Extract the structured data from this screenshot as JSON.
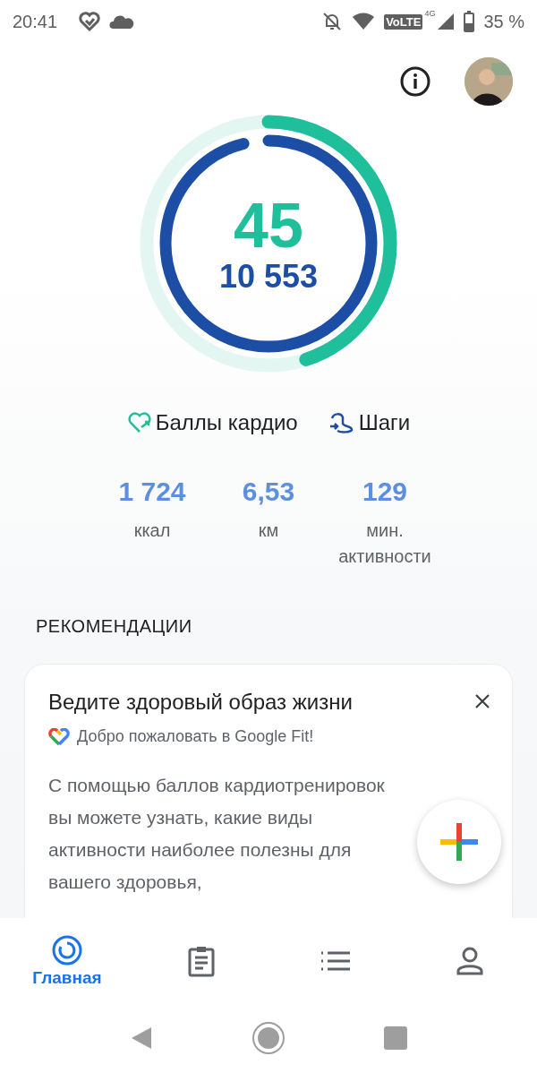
{
  "status_bar": {
    "time": "20:41",
    "volte": "VoLTE",
    "network": "4G",
    "battery": "35 %"
  },
  "rings": [
    {
      "kind": "cardio",
      "value": "45",
      "level": 0.45
    },
    {
      "kind": "steps",
      "value": "10 553",
      "level": 0.96
    }
  ],
  "legend": [
    {
      "kind": "cardio",
      "label": "Баллы кардио"
    },
    {
      "kind": "steps",
      "label": "Шаги"
    }
  ],
  "stats": [
    {
      "value": "1 724",
      "label": "ккал"
    },
    {
      "value": "6,53",
      "label": "км"
    },
    {
      "value": "129",
      "label": "мин. активности"
    }
  ],
  "section_title": "РЕКОМЕНДАЦИИ",
  "card": {
    "title": "Ведите здоровый образ жизни",
    "source": "Добро пожаловать в Google Fit!",
    "body": "С помощью баллов кардиотренировок вы можете узнать, какие виды активности наиболее полезны для вашего здоровья,"
  },
  "bottom_nav": [
    {
      "kind": "home",
      "label": "Главная",
      "selected": true
    },
    {
      "kind": "journal",
      "selected": false
    },
    {
      "kind": "browse",
      "selected": false
    },
    {
      "kind": "profile",
      "selected": false
    }
  ]
}
